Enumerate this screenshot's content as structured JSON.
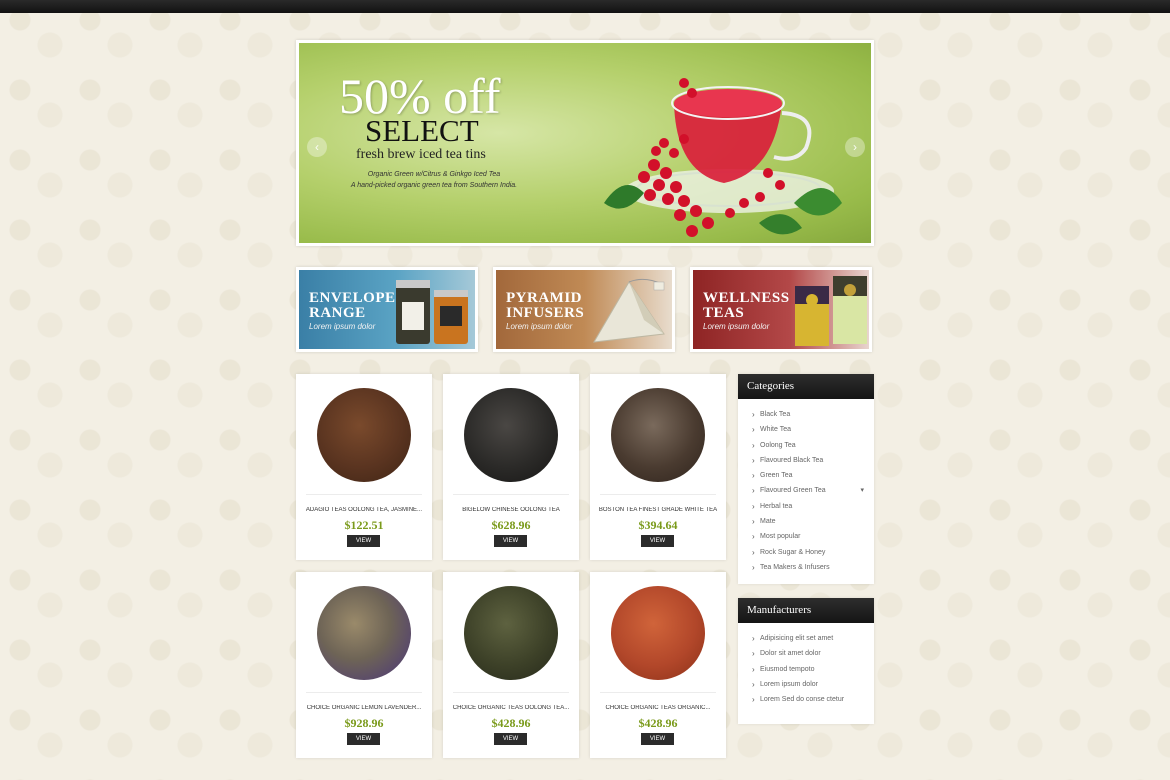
{
  "slider": {
    "headline": "50% off",
    "subheadline": "SELECT",
    "tagline": "fresh brew iced tea tins",
    "desc_line1": "Organic Green w/Citrus & Ginkgo Iced Tea",
    "desc_line2": "A hand-picked organic green tea from Southern India.",
    "prev_glyph": "‹",
    "next_glyph": "›"
  },
  "banners": [
    {
      "line1": "ENVELOPE",
      "line2": "RANGE",
      "sub": "Lorem ipsum  dolor",
      "color": "#3a7fa6"
    },
    {
      "line1": "PYRAMID",
      "line2": "INFUSERS",
      "sub": "Lorem ipsum  dolor",
      "color": "#b07a48"
    },
    {
      "line1": "WELLNESS",
      "line2": "TEAS",
      "sub": "Lorem ipsum  dolor",
      "color": "#9e3232"
    }
  ],
  "products": [
    {
      "name": "ADAGIO TEAS OOLONG TEA, JASMINE...",
      "price": "$122.51",
      "view": "VIEW",
      "tea_color": "#5a3420"
    },
    {
      "name": "BIGELOW CHINESE OOLONG TEA",
      "price": "$628.96",
      "view": "VIEW",
      "tea_color": "#2b2a28"
    },
    {
      "name": "BOSTON TEA FINEST GRADE WHITE TEA",
      "price": "$394.64",
      "view": "VIEW",
      "tea_color": "#4a3b30"
    },
    {
      "name": "CHOICE ORGANIC LEMON LAVENDER...",
      "price": "$928.96",
      "view": "VIEW",
      "tea_color": "#6e6456"
    },
    {
      "name": "CHOICE ORGANIC TEAS OOLONG TEA...",
      "price": "$428.96",
      "view": "VIEW",
      "tea_color": "#3d4128"
    },
    {
      "name": "CHOICE ORGANIC TEAS ORGANIC...",
      "price": "$428.96",
      "view": "VIEW",
      "tea_color": "#b2472a"
    }
  ],
  "categories": {
    "title": "Categories",
    "items": [
      "Black Tea",
      "White Tea",
      "Oolong Tea",
      "Flavoured Black Tea",
      "Green Tea",
      "Flavoured Green Tea",
      "Herbal tea",
      "Mate",
      "Most popular",
      "Rock Sugar & Honey",
      "Tea Makers & Infusers"
    ],
    "expander": "▾"
  },
  "manufacturers": {
    "title": "Manufacturers",
    "items": [
      "Adipisicing elit set amet",
      "Dolor sit amet dolor",
      "Eiusmod tempoto",
      "Lorem ipsum dolor",
      "Lorem Sed do conse ctetur"
    ]
  },
  "colors": {
    "accent_price": "#7a9a1a",
    "dark": "#1a1a1a",
    "page_bg": "#f3efe4"
  }
}
